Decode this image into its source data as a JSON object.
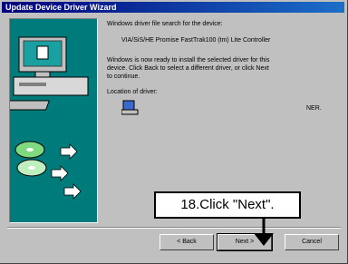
{
  "window": {
    "title": "Update Device Driver Wizard"
  },
  "content": {
    "line1": "Windows driver file search for the device:",
    "device_name": "VIA/SiS/HE Promise FastTrak100 (tm) Lite Controller",
    "ready_line1": "Windows is now ready to install the selected driver for this",
    "ready_line2": "device. Click Back to select a different driver, or click Next",
    "ready_line3": "to continue.",
    "location_label": "Location of driver:",
    "location_path_tail": "NER."
  },
  "buttons": {
    "back_label": "< Back",
    "next_label": "Next >",
    "cancel_label": "Cancel"
  },
  "callout": {
    "text": "18.Click \"Next\"."
  },
  "icons": [
    "computer-icon",
    "cd-disc-icon",
    "arrow-icon",
    "driver-file-icon"
  ]
}
